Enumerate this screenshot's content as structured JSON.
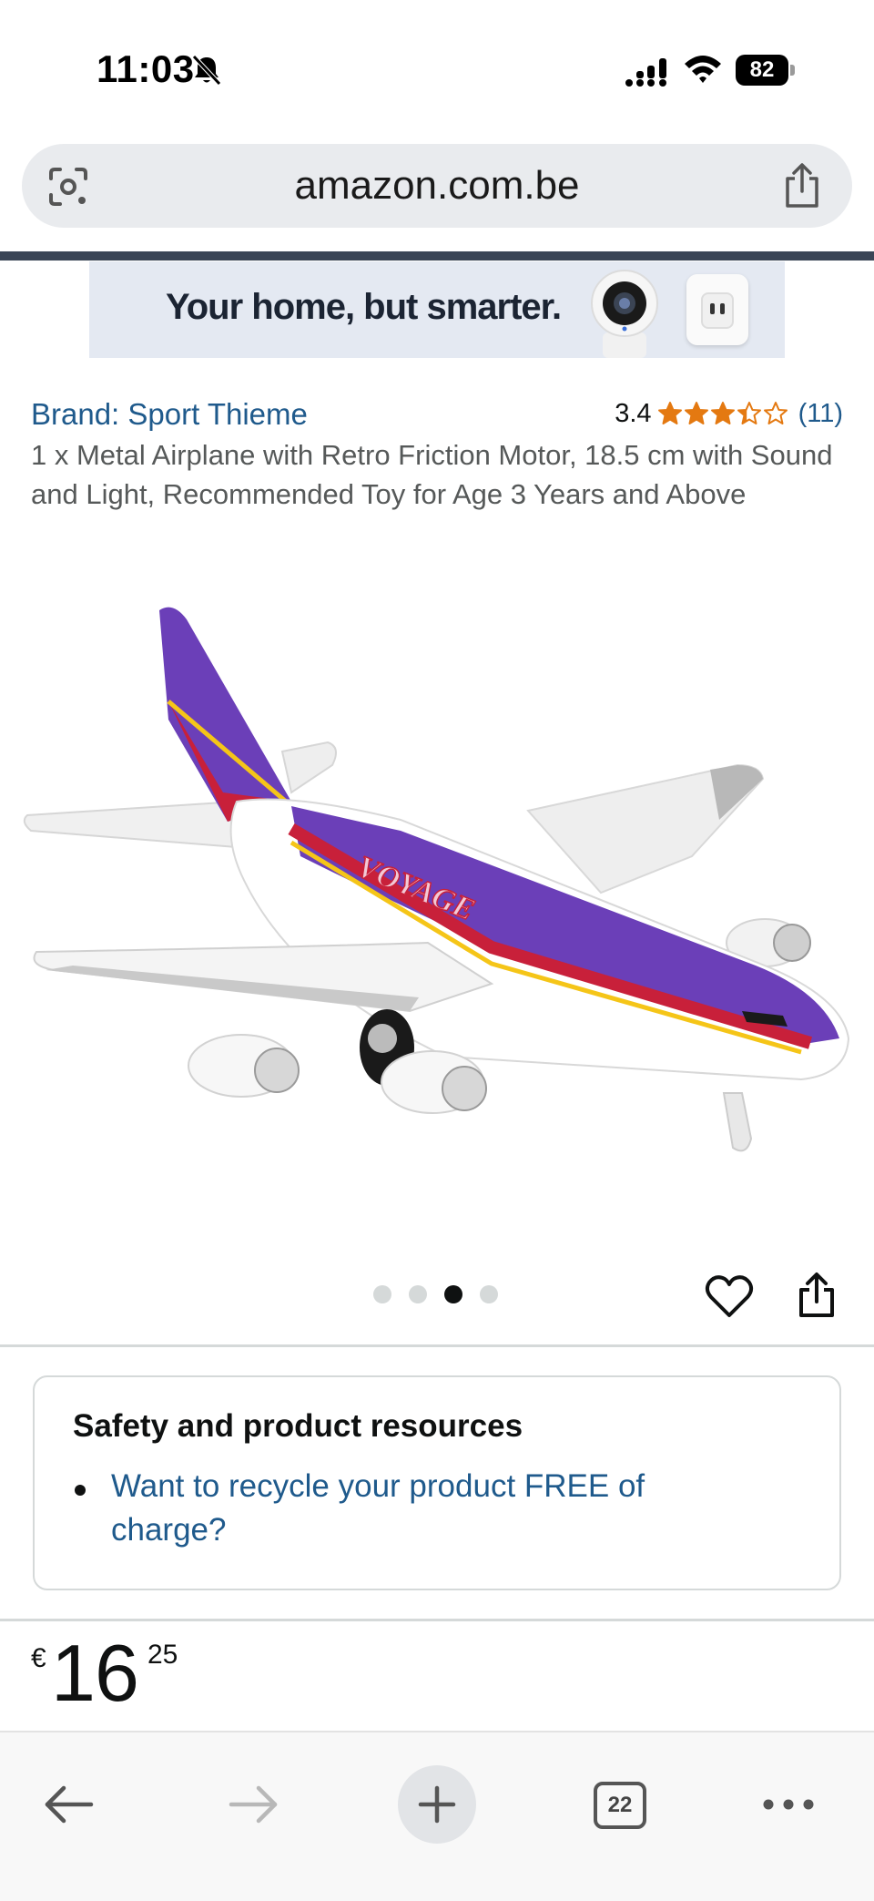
{
  "status_bar": {
    "time": "11:03",
    "battery": "82",
    "icons": [
      "bell-slash-icon",
      "signal-icon",
      "wifi-icon",
      "battery-icon"
    ]
  },
  "browser": {
    "url": "amazon.com.be",
    "tab_count": "22",
    "icons": [
      "lens-icon",
      "share-icon",
      "back-icon",
      "forward-icon",
      "plus-icon",
      "more-icon"
    ]
  },
  "ad": {
    "headline": "Your home, but smarter."
  },
  "product": {
    "brand": "Brand: Sport Thieme",
    "rating_value": "3.4",
    "rating_stars": 3.4,
    "rating_count": "(11)",
    "title": "1 x Metal Airplane with Retro Friction Motor, 18.5 cm with Sound and Light, Recommended Toy for Age 3 Years and Above",
    "image_count": 4,
    "active_image_index": 2,
    "airplane_livery_text": "VOYAGE"
  },
  "safety": {
    "heading": "Safety and product resources",
    "link": "Want to recycle your product FREE of charge?"
  },
  "price": {
    "symbol": "€",
    "whole": "16",
    "fraction": "25"
  },
  "colors": {
    "link": "#1f5a8c",
    "star": "#e47911",
    "plane_purple": "#6b3fb8",
    "plane_red": "#c8203a"
  }
}
